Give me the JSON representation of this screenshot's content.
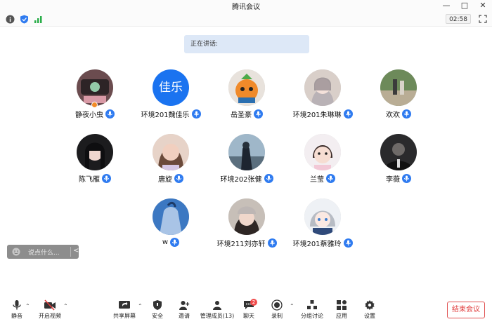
{
  "window": {
    "title": "腾讯会议",
    "minimize": "—",
    "maximize": "□",
    "close": "✕"
  },
  "status": {
    "timer": "02:58"
  },
  "speaking_label": "正在讲话:",
  "participants": [
    {
      "name": "静夜小虫",
      "avatar_text": ""
    },
    {
      "name": "环境201魏佳乐",
      "avatar_text": "佳乐"
    },
    {
      "name": "岳圣豪",
      "avatar_text": ""
    },
    {
      "name": "环境201朱琳琳",
      "avatar_text": ""
    },
    {
      "name": "欢欢",
      "avatar_text": ""
    },
    {
      "name": "陈飞雁",
      "avatar_text": ""
    },
    {
      "name": "唐旋",
      "avatar_text": ""
    },
    {
      "name": "环境202张健",
      "avatar_text": ""
    },
    {
      "name": "兰莹",
      "avatar_text": ""
    },
    {
      "name": "李薇",
      "avatar_text": ""
    },
    {
      "name": "w",
      "avatar_text": ""
    },
    {
      "name": "环境211刘亦轩",
      "avatar_text": ""
    },
    {
      "name": "环境201蔡雅玲",
      "avatar_text": ""
    }
  ],
  "chat": {
    "placeholder": "说点什么...",
    "collapse": "<"
  },
  "toolbar": {
    "mute": "静音",
    "video": "开启视频",
    "share": "共享屏幕",
    "security": "安全",
    "invite": "邀请",
    "members": "管理成员(13)",
    "chat": "聊天",
    "chat_unread": "2",
    "record": "录制",
    "breakout": "分组讨论",
    "apps": "应用",
    "settings": "设置",
    "end": "结束会议"
  },
  "colors": {
    "accent": "#2f7bf0",
    "end_red": "#e03a3a"
  }
}
